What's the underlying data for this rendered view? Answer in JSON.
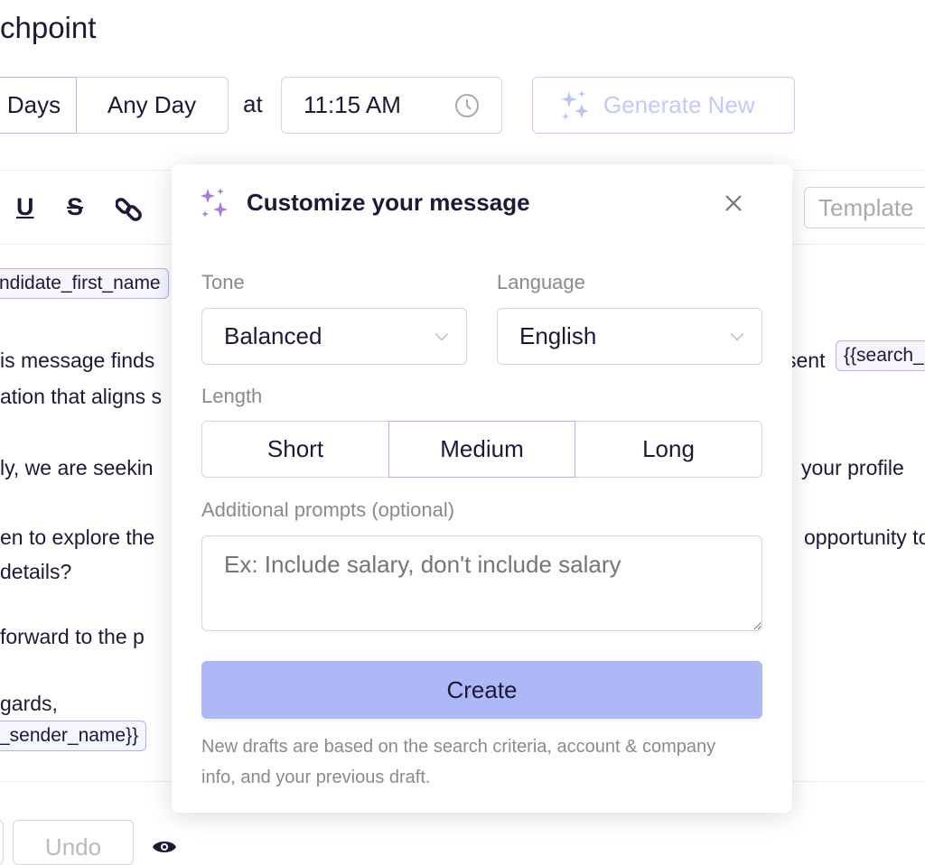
{
  "page": {
    "title": "chpoint"
  },
  "schedule": {
    "days_label": "Days",
    "any_day_label": "Any Day",
    "at_label": "at",
    "time_value": "11:15 AM",
    "generate_label": "Generate New"
  },
  "toolbar": {
    "template_label": "Template"
  },
  "body": {
    "chip_first_name": "ndidate_first_name",
    "line1": "is message finds",
    "line1_right": "sent",
    "chip_search": "{{search_",
    "line2": "ation that aligns s",
    "line3": "ly, we are seekin",
    "line3_right": "your profile",
    "line4": "en to explore the",
    "line4_right": "opportunity to",
    "line5": " details?",
    "line6": " forward to the p",
    "line7": "gards,",
    "chip_sender": "_sender_name}}"
  },
  "footer": {
    "undo_label": "Undo"
  },
  "modal": {
    "title": "Customize your message",
    "tone_label": "Tone",
    "tone_value": "Balanced",
    "language_label": "Language",
    "language_value": "English",
    "length_label": "Length",
    "length_options": [
      "Short",
      "Medium",
      "Long"
    ],
    "length_selected": "Medium",
    "prompts_label": "Additional prompts (optional)",
    "prompts_placeholder": "Ex: Include salary, don't include salary",
    "create_label": "Create",
    "note": "New drafts are based on the search criteria, account & company info, and your previous draft."
  },
  "colors": {
    "accent": "#adb8f7",
    "sparkle": "#a77be0",
    "text": "#1e1838"
  }
}
